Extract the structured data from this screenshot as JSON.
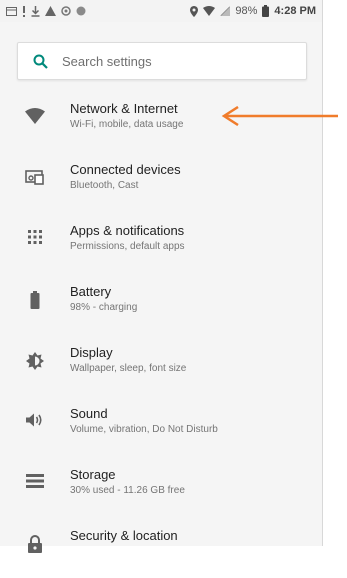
{
  "status_bar": {
    "battery_text": "98%",
    "time": "4:28 PM"
  },
  "search": {
    "placeholder": "Search settings"
  },
  "items": [
    {
      "title": "Network & Internet",
      "subtitle": "Wi-Fi, mobile, data usage",
      "icon": "wifi-icon"
    },
    {
      "title": "Connected devices",
      "subtitle": "Bluetooth, Cast",
      "icon": "devices-icon"
    },
    {
      "title": "Apps & notifications",
      "subtitle": "Permissions, default apps",
      "icon": "apps-icon"
    },
    {
      "title": "Battery",
      "subtitle": "98% - charging",
      "icon": "battery-icon"
    },
    {
      "title": "Display",
      "subtitle": "Wallpaper, sleep, font size",
      "icon": "display-icon"
    },
    {
      "title": "Sound",
      "subtitle": "Volume, vibration, Do Not Disturb",
      "icon": "sound-icon"
    },
    {
      "title": "Storage",
      "subtitle": "30% used - 11.26 GB free",
      "icon": "storage-icon"
    },
    {
      "title": "Security & location",
      "subtitle": "",
      "icon": "lock-icon"
    }
  ],
  "colors": {
    "accent": "#00897b",
    "arrow": "#f07c2b"
  }
}
